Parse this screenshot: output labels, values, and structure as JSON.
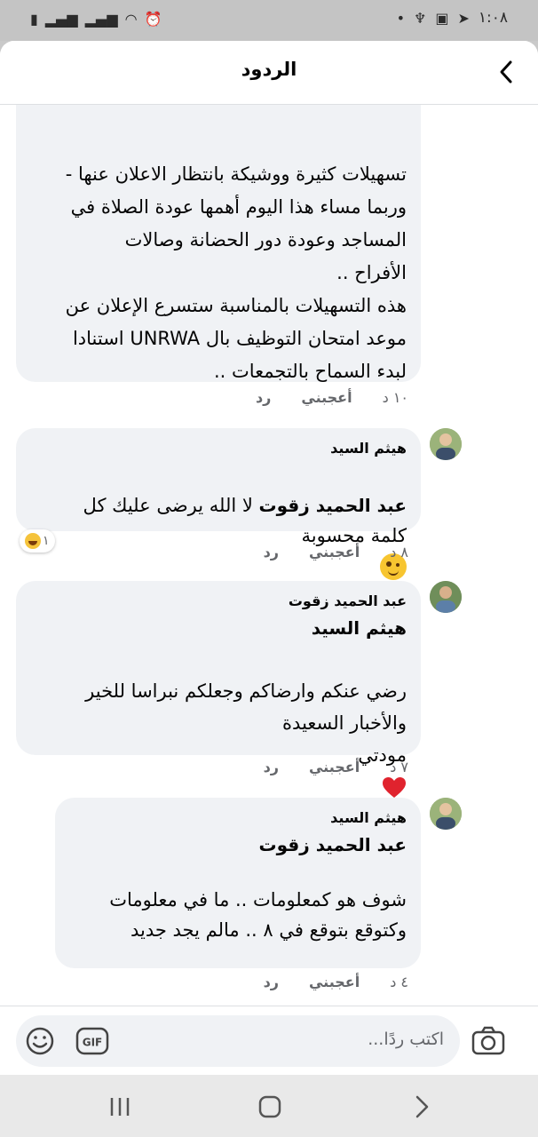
{
  "status_bar": {
    "time": "١:٠٨"
  },
  "header": {
    "title": "الردود"
  },
  "comments": [
    {
      "partial_text": "تسهيلات كثيرة ووشيكة بانتظار الاعلان عنها -\nوربما مساء هذا اليوم  أهمها عودة الصلاة في\nالمساجد وعودة دور الحضانة وصالات\nالأفراح ..\nهذه التسهيلات بالمناسبة ستسرع الإعلان عن\nموعد امتحان التوظيف بال UNRWA استنادا\nلبدء السماح بالتجمعات ..",
      "time": "١٠ د",
      "like": "أعجبني",
      "reply": "رد"
    },
    {
      "author": "هيثم السيد",
      "mention": "عبد الحميد زقوت",
      "text": "  لا الله يرضى عليك كل\nكلمة محسوبة",
      "emoji": "wink",
      "reaction_count": "١",
      "time": "٨ د",
      "like": "أعجبني",
      "reply": "رد"
    },
    {
      "author": "عبد الحميد زقوت",
      "mention": "هيثم السيد",
      "text": "رضي عنكم وارضاكم وجعلكم نبراسا للخير\nوالأخبار السعيدة\nمودتي",
      "emoji": "heart",
      "time": "٧ د",
      "like": "أعجبني",
      "reply": "رد"
    },
    {
      "author": "هيثم السيد",
      "mention": "عبد الحميد زقوت",
      "text": "شوف هو كمعلومات .. ما في معلومات\nوكتوقع بتوقع في ٨ ..  مالم يجد جديد",
      "time": "٤ د",
      "like": "أعجبني",
      "reply": "رد"
    }
  ],
  "composer": {
    "placeholder": "اكتب ردًا...",
    "gif_label": "GIF"
  }
}
